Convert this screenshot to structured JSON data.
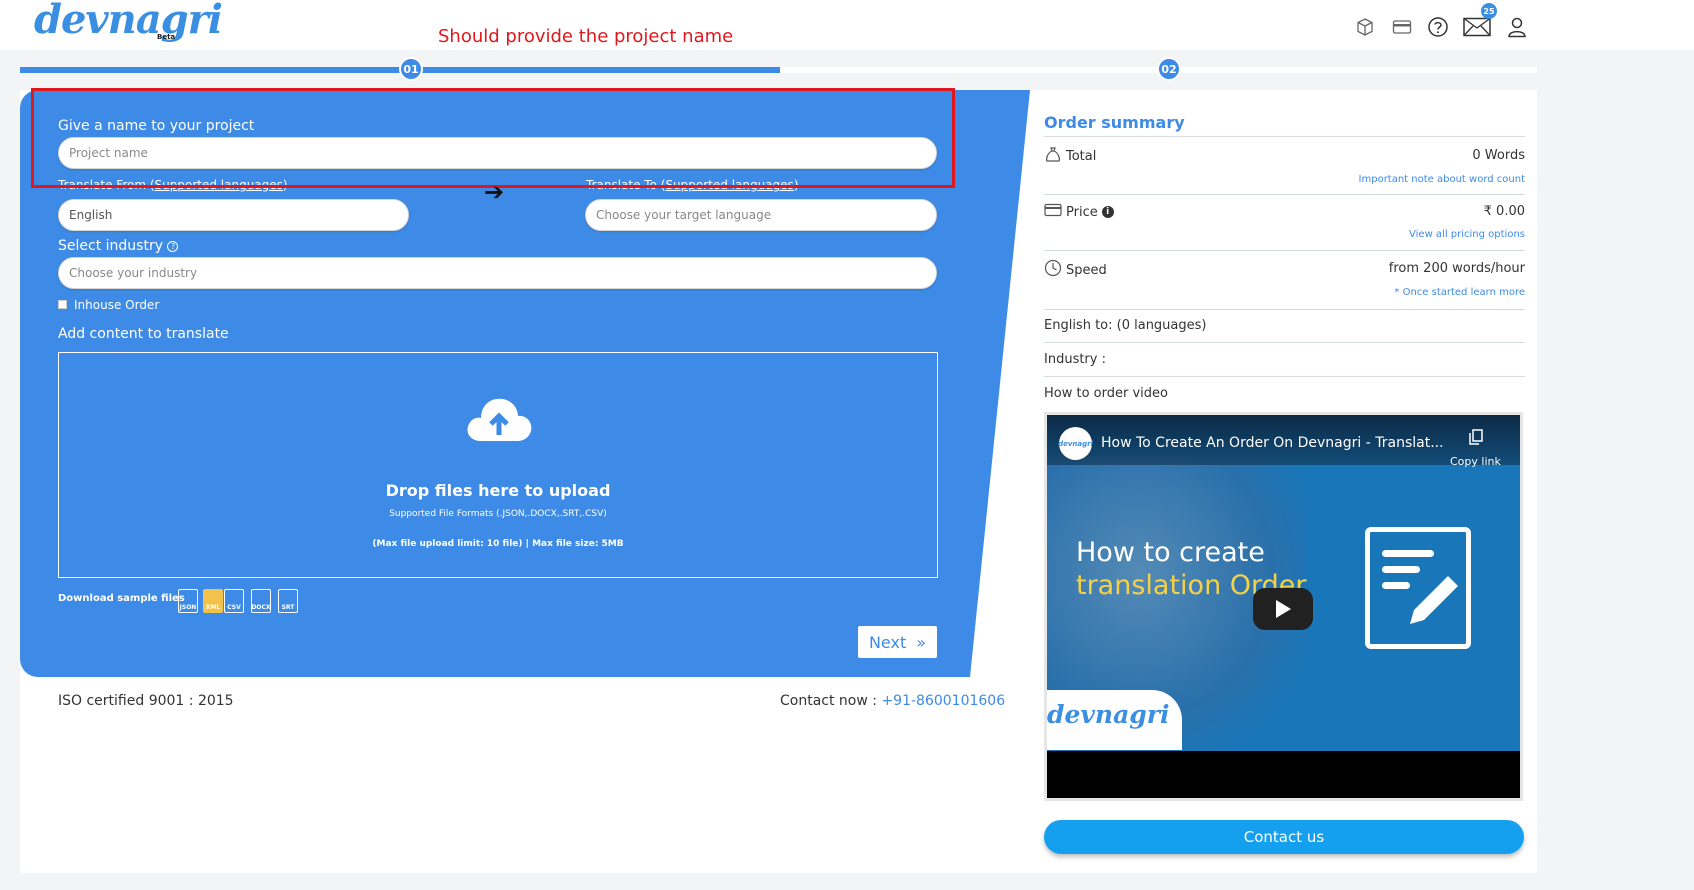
{
  "header": {
    "logo_text": "devnagri",
    "logo_sub": "Beta",
    "annotation": "Should provide the project name",
    "mail_badge": "25",
    "icons": [
      "box-icon",
      "card-icon",
      "help-icon",
      "mail-icon",
      "user-icon"
    ]
  },
  "steps": {
    "step1": "01",
    "step2": "02"
  },
  "form": {
    "project_label": "Give a name to your project",
    "project_placeholder": "Project name",
    "translate_from_label": "Translate From",
    "translate_from_link": "Supported languages",
    "translate_from_value": "English",
    "translate_to_label": "Translate To",
    "translate_to_link": "Supported languages",
    "translate_to_placeholder": "Choose your target language",
    "industry_label": "Select industry",
    "industry_placeholder": "Choose your industry",
    "inhouse_label": "Inhouse Order",
    "content_label": "Add content to translate",
    "drop_title": "Drop files here to upload",
    "drop_formats": "Supported File Formats (.JSON,.DOCX,.SRT,.CSV)",
    "drop_limit": "(Max file upload limit: 10 file) | Max file size: 5MB",
    "download_label": "Download sample files",
    "sample_files": [
      "JSON",
      "XML",
      "CSV",
      "DOCX",
      "SRT"
    ],
    "next_label": "Next"
  },
  "footer": {
    "iso": "ISO certified 9001 : 2015",
    "contact_label": "Contact now :",
    "contact_phone": "+91-8600101606"
  },
  "summary": {
    "title": "Order summary",
    "total_label": "Total",
    "total_value": "0 Words",
    "total_link": "Important note about word count",
    "price_label": "Price",
    "price_value": "₹ 0.00",
    "price_link": "View all pricing options",
    "speed_label": "Speed",
    "speed_value": "from 200 words/hour",
    "speed_link": "* Once started learn more",
    "languages": "English to: (0 languages)",
    "industry": "Industry :",
    "video_label": "How to order video",
    "contact_button": "Contact us"
  },
  "video": {
    "title": "How To Create An Order On Devnagri - Translat...",
    "copy_link": "Copy link",
    "line1": "How to create",
    "line2": "translation Order",
    "brand": "devnagri",
    "avatar_text": "devnagri"
  },
  "colors": {
    "primary": "#3d8be6",
    "annotation": "#e0171c",
    "contact": "#14a0ef"
  }
}
